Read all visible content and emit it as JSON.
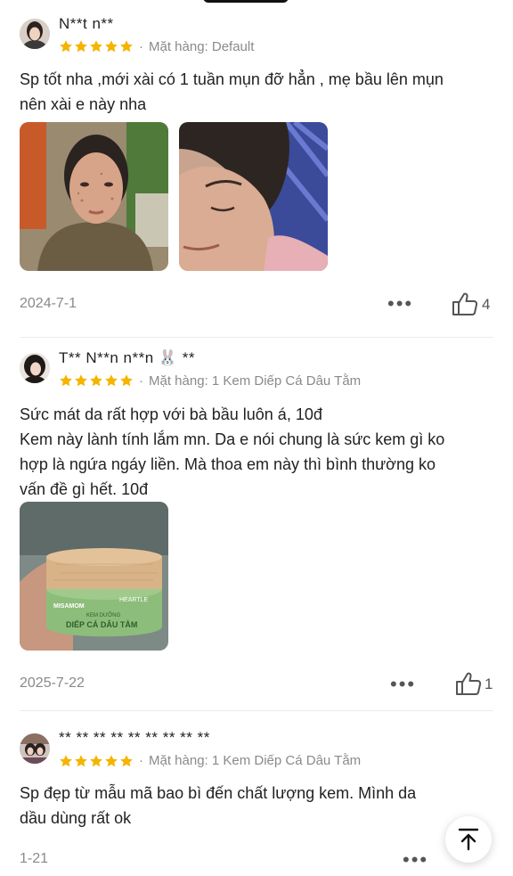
{
  "reviews": [
    {
      "username": "N**t n**",
      "variation_label": "Mặt hàng: Default",
      "comment_lines": [
        "Sp tốt nha ,mới xài có 1 tuần mụn đỡ hẳn , mẹ bầu lên mụn",
        "nên xài e này nha"
      ],
      "date": "2024-7-1",
      "likes": "4",
      "rating": 5
    },
    {
      "username": "T** N**n n**n 🐰 **",
      "variation_label": "Mặt hàng: 1 Kem Diếp Cá Dâu Tằm",
      "comment_lines": [
        "Sức mát da rất hợp với bà bầu luôn á, 10đ",
        "Kem này lành tính lắm mn. Da e nói chung là sức kem gì ko",
        "hợp là ngứa ngáy liền. Mà thoa em này thì bình thường ko",
        "vấn đề gì hết. 10đ"
      ],
      "date": "2025-7-22",
      "likes": "1",
      "rating": 5,
      "product_label": {
        "brand": "MISAMOM",
        "brand_right": "HEARTLE",
        "line1": "KEM DƯỠNG",
        "line2": "DIẾP CÁ DÂU TẰM"
      }
    },
    {
      "username": "** ** ** ** ** ** ** ** **",
      "variation_label": "Mặt hàng: 1 Kem Diếp Cá Dâu Tằm",
      "comment_lines": [
        "Sp đẹp từ mẫu mã bao bì đến chất lượng kem. Mình da",
        "dầu dùng rất ok"
      ],
      "date": "1-21",
      "rating": 5
    }
  ],
  "colors": {
    "star": "#f5b400",
    "muted": "#8a8a8a",
    "text": "#222222"
  },
  "icons": {
    "more": "more-dots-icon",
    "like": "thumbs-up-icon",
    "top": "scroll-to-top-icon"
  },
  "more_glyph": "•••",
  "bullet": "·"
}
